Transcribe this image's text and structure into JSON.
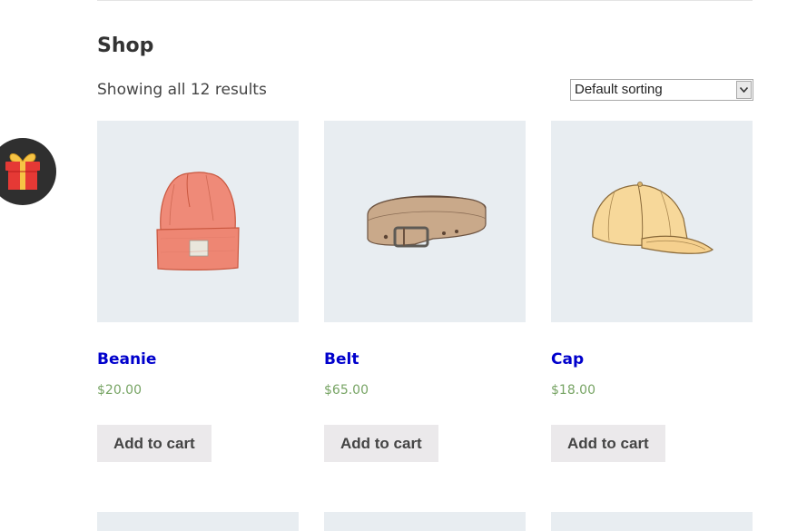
{
  "page": {
    "title": "Shop",
    "result_count": "Showing all 12 results"
  },
  "sorting": {
    "selected": "Default sorting"
  },
  "products": [
    {
      "name": "Beanie",
      "price": "$20.00",
      "button": "Add to cart",
      "image_icon": "beanie-image"
    },
    {
      "name": "Belt",
      "price": "$65.00",
      "button": "Add to cart",
      "image_icon": "belt-image"
    },
    {
      "name": "Cap",
      "price": "$18.00",
      "button": "Add to cart",
      "image_icon": "cap-image"
    }
  ],
  "colors": {
    "product_link": "#0000cc",
    "price": "#77a464",
    "button_bg": "#ebe9eb",
    "thumb_bg": "#e8edf1",
    "gift_badge_bg": "#2f2f2f"
  },
  "floating": {
    "icon": "gift-icon"
  }
}
